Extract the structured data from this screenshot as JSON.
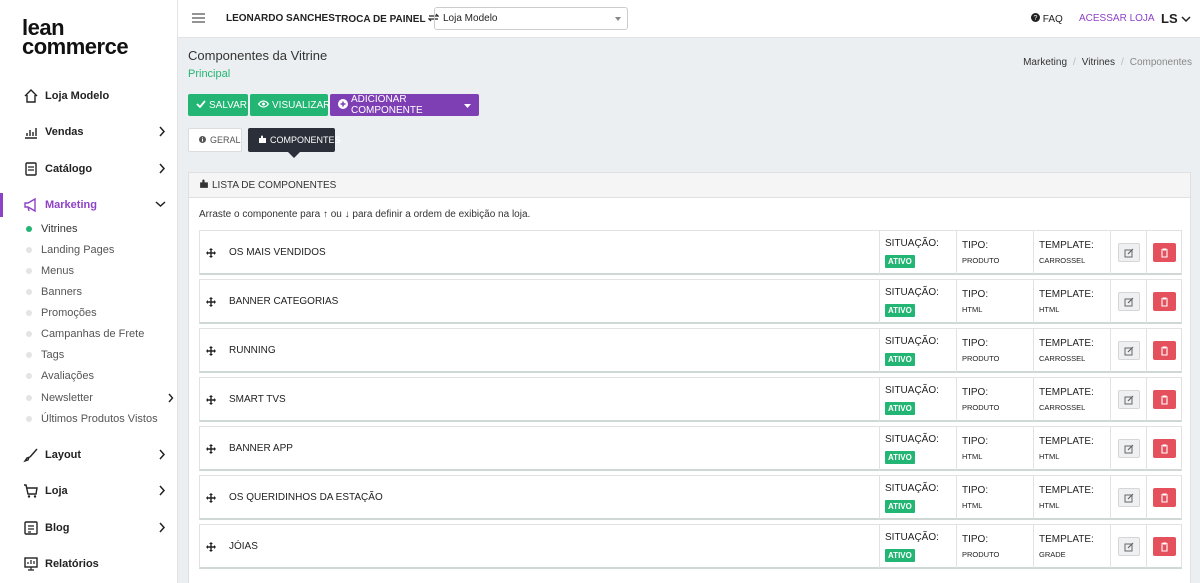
{
  "brand": {
    "line1": "lean",
    "line2": "commerce"
  },
  "sidebar": {
    "items": [
      {
        "label": "Loja Modelo",
        "icon": "home-icon"
      },
      {
        "label": "Vendas",
        "icon": "chart-icon"
      },
      {
        "label": "Catálogo",
        "icon": "catalog-icon"
      },
      {
        "label": "Marketing",
        "icon": "megaphone-icon"
      },
      {
        "label": "Layout",
        "icon": "brush-icon"
      },
      {
        "label": "Loja",
        "icon": "cart-icon"
      },
      {
        "label": "Blog",
        "icon": "blog-icon"
      },
      {
        "label": "Relatórios",
        "icon": "report-icon"
      }
    ],
    "marketing_sub": [
      "Vitrines",
      "Landing Pages",
      "Menus",
      "Banners",
      "Promoções",
      "Campanhas de Frete",
      "Tags",
      "Avaliações",
      "Newsletter",
      "Últimos Produtos Vistos"
    ]
  },
  "topbar": {
    "user": "LEONARDO SANCHES",
    "switch_panel": "TROCA DE PAINEL",
    "store_selected": "Loja Modelo",
    "faq": "FAQ",
    "access_store": "ACESSAR LOJA",
    "avatar": "LS"
  },
  "page": {
    "title": "Componentes da Vitrine",
    "subtitle": "Principal",
    "breadcrumb": [
      "Marketing",
      "Vitrines",
      "Componentes"
    ]
  },
  "actions": {
    "save": "SALVAR",
    "view": "VISUALIZAR",
    "add": "ADICIONAR COMPONENTE"
  },
  "tabs": {
    "general": "GERAL",
    "components": "COMPONENTES"
  },
  "panel": {
    "header": "LISTA DE COMPONENTES",
    "hint": "Arraste o componente para ↑ ou ↓ para definir a ordem de exibição na loja.",
    "labels": {
      "status": "SITUAÇÃO:",
      "type": "TIPO:",
      "template": "TEMPLATE:"
    },
    "rows": [
      {
        "name": "OS MAIS VENDIDOS",
        "status": "ATIVO",
        "type": "PRODUTO",
        "template": "CARROSSEL"
      },
      {
        "name": "BANNER CATEGORIAS",
        "status": "ATIVO",
        "type": "HTML",
        "template": "HTML"
      },
      {
        "name": "RUNNING",
        "status": "ATIVO",
        "type": "PRODUTO",
        "template": "CARROSSEL"
      },
      {
        "name": "SMART TVS",
        "status": "ATIVO",
        "type": "PRODUTO",
        "template": "CARROSSEL"
      },
      {
        "name": "BANNER APP",
        "status": "ATIVO",
        "type": "HTML",
        "template": "HTML"
      },
      {
        "name": "OS QUERIDINHOS DA ESTAÇÃO",
        "status": "ATIVO",
        "type": "HTML",
        "template": "HTML"
      },
      {
        "name": "JÓIAS",
        "status": "ATIVO",
        "type": "PRODUTO",
        "template": "GRADE"
      }
    ]
  },
  "colors": {
    "accent": "#8d42c7",
    "success": "#22b573",
    "danger": "#e5505d",
    "dark": "#2b2f3a"
  }
}
